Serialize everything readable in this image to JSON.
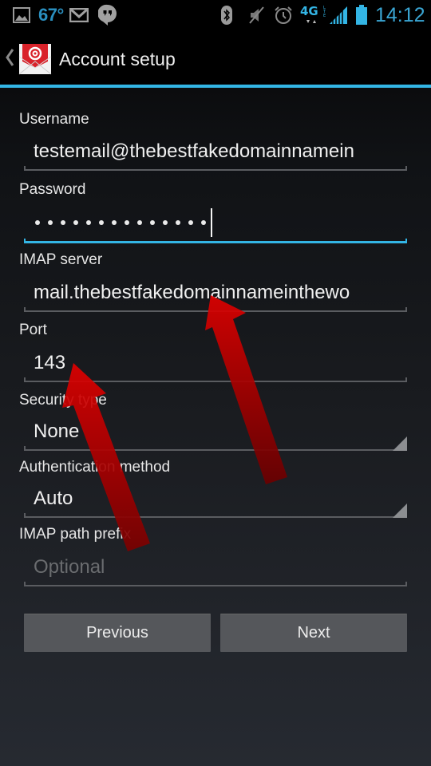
{
  "status_bar": {
    "temperature": "67°",
    "time": "14:12",
    "network_type": "4G",
    "network_sub": "LTE",
    "icons": [
      "gallery-icon",
      "gmail-icon",
      "hangouts-icon",
      "bluetooth-icon",
      "mute-icon",
      "alarm-icon",
      "4g-lte-icon",
      "signal-icon",
      "battery-icon"
    ],
    "accent_color": "#33b5e5"
  },
  "action_bar": {
    "title": "Account setup",
    "icon": "email-app-icon"
  },
  "form": {
    "username": {
      "label": "Username",
      "value": "testemail@thebestfakedomainnamein"
    },
    "password": {
      "label": "Password",
      "masked_length": 14
    },
    "imap_server": {
      "label": "IMAP server",
      "value": "mail.thebestfakedomainnameinthewo"
    },
    "port": {
      "label": "Port",
      "value": "143"
    },
    "security_type": {
      "label": "Security type",
      "selected": "None"
    },
    "auth_method": {
      "label": "Authentication method",
      "selected": "Auto"
    },
    "imap_path_prefix": {
      "label": "IMAP path prefix",
      "value": "",
      "placeholder": "Optional"
    }
  },
  "buttons": {
    "previous": "Previous",
    "next": "Next"
  },
  "annotations": {
    "arrow_color": "#d10000",
    "arrows": [
      "arrow-to-port",
      "arrow-to-imap-server"
    ]
  }
}
